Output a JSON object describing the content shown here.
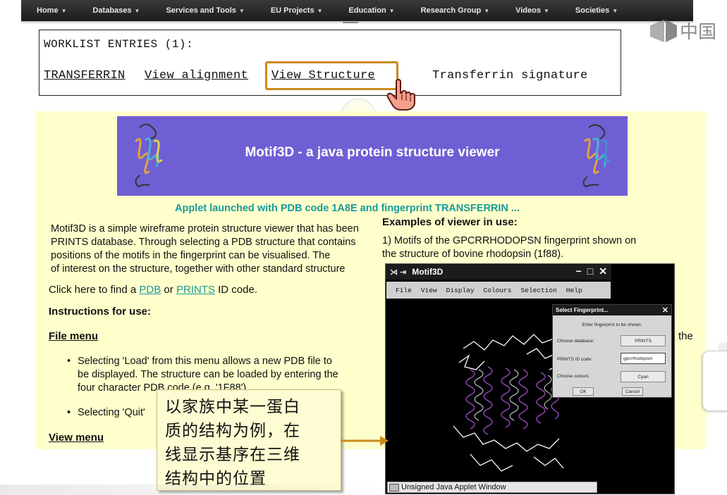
{
  "nav": {
    "items": [
      "Home",
      "Databases",
      "Services and Tools",
      "EU Projects",
      "Education",
      "Research Group",
      "Videos",
      "Societies"
    ]
  },
  "worklist": {
    "title": "WORKLIST ENTRIES (1):",
    "link_transferrin": "TRANSFERRIN",
    "link_view_alignment": "View alignment",
    "link_view_structure": "View Structure",
    "signature": "Transferrin signature"
  },
  "watermark": {
    "text": "中国"
  },
  "banner": {
    "title": "Motif3D - a java protein structure viewer"
  },
  "content": {
    "applet_line": "Applet launched with PDB code 1A8E and fingerprint TRANSFERRIN ...",
    "intro_lines": [
      "Motif3D is a simple wireframe protein structure viewer that has been",
      "PRINTS database.  Through selecting a PDB structure that contains",
      "positions of the motifs in the fingerprint can be visualised.  The",
      "of interest on the structure, together with other standard structure"
    ],
    "click_here": "Click here to find a",
    "pdb_link": "PDB",
    "or_text": "or",
    "prints_link": "PRINTS",
    "id_code": "ID code.",
    "instructions_title": "Instructions for use:",
    "file_menu": "File menu",
    "load_lines": [
      "Selecting 'Load' from this menu allows a new PDB file to",
      "be displayed. The structure can be loaded by entering the",
      "four character PDB code (e.g. '1F88')."
    ],
    "quit_text": "Selecting 'Quit'",
    "view_menu": "View menu",
    "examples_title": "Examples of viewer in use:",
    "example1_lines": [
      "1) Motifs of the GPCRRHODOPSN fingerprint shown on",
      "the structure of bovine rhodopsin (1f88)."
    ],
    "the_word": "the",
    "bullet": "•"
  },
  "applet": {
    "title": "Motif3D",
    "titlebar_left": "⋊ ⇥",
    "ctrl_minimize": "−",
    "ctrl_maximize": "□",
    "ctrl_close": "✕",
    "menu": [
      "File",
      "View",
      "Display",
      "Colours",
      "Selection",
      "Help"
    ],
    "status": "Unsigned Java Applet Window"
  },
  "dialog": {
    "title": "Select Fingerprint...",
    "close": "✕",
    "prompt": "Enter fingerprint to be shown:",
    "database_label": "Choose database:",
    "database_value": "PRINTS",
    "id_label": "PRINTS ID code:",
    "id_value": "gpcrrhodopsin",
    "colours_label": "Choose colours",
    "colours_value": "Cyan",
    "ok": "OK",
    "cancel": "Cancel"
  },
  "note": {
    "lines": [
      "以家族中某一蛋白",
      "质的结构为例，在",
      "线显示基序在三维",
      "结构中的位置"
    ]
  },
  "colors": {
    "nav_bg": "#2a2a2a",
    "highlight_border": "#c98a1b",
    "banner_bg": "#6f5fd4",
    "page_yellow": "#ffffcc",
    "link_teal": "#1a9a9a",
    "note_bg": "#fefcd2",
    "helix_purple": "#8a3fa6"
  }
}
